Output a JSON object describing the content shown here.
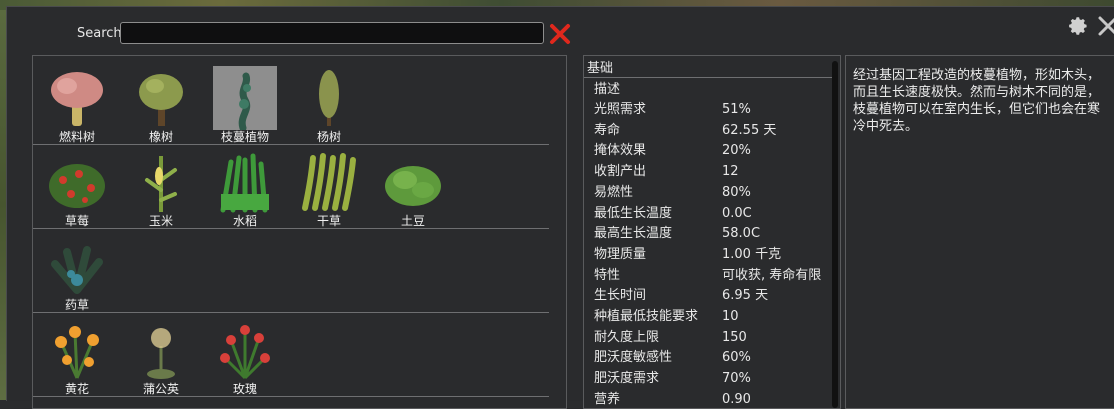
{
  "search": {
    "label": "Search",
    "value": ""
  },
  "plant_rows": [
    [
      "燃料树",
      "橡树",
      "枝蔓植物",
      "杨树"
    ],
    [
      "草莓",
      "玉米",
      "水稻",
      "干草",
      "土豆"
    ],
    [
      "药草"
    ],
    [
      "黄花",
      "蒲公英",
      "玫瑰"
    ]
  ],
  "selected_plant": "枝蔓植物",
  "stats": {
    "header": "基础",
    "description_label": "描述",
    "rows": [
      {
        "label": "光照需求",
        "value": "51%"
      },
      {
        "label": "寿命",
        "value": "62.55 天"
      },
      {
        "label": "掩体效果",
        "value": "20%"
      },
      {
        "label": "收割产出",
        "value": "12"
      },
      {
        "label": "易燃性",
        "value": "80%"
      },
      {
        "label": "最低生长温度",
        "value": "0.0C"
      },
      {
        "label": "最高生长温度",
        "value": "58.0C"
      },
      {
        "label": "物理质量",
        "value": "1.00 千克"
      },
      {
        "label": "特性",
        "value": "可收获, 寿命有限"
      },
      {
        "label": "生长时间",
        "value": "6.95 天"
      },
      {
        "label": "种植最低技能要求",
        "value": "10"
      },
      {
        "label": "耐久度上限",
        "value": "150"
      },
      {
        "label": "肥沃度敏感性",
        "value": "60%"
      },
      {
        "label": "肥沃度需求",
        "value": "70%"
      },
      {
        "label": "营养",
        "value": "0.90"
      }
    ]
  },
  "description": "经过基因工程改造的枝蔓植物，形如木头，而且生长速度极快。然而与树木不同的是，枝蔓植物可以在室内生长，但它们也会在寒冷中死去。",
  "colors": {
    "accent_red": "#e0281d",
    "panel_bg": "#2a2b2d",
    "selected_bg": "#8e8e8e"
  },
  "icons": {
    "clear": "red-x-icon",
    "settings": "gear-icon",
    "close": "close-icon"
  }
}
